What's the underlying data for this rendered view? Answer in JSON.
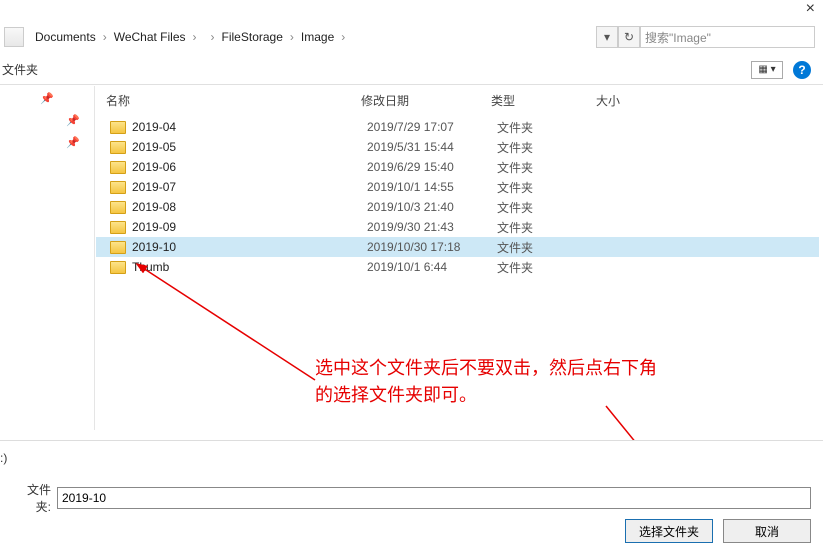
{
  "close_x": "×",
  "breadcrumb": [
    "Documents",
    "WeChat Files",
    "",
    "FileStorage",
    "Image"
  ],
  "search_placeholder": "搜索\"Image\"",
  "toolbar_left": "文件夹",
  "view_icon_text": "▦ ▾",
  "headers": {
    "name": "名称",
    "date": "修改日期",
    "type": "类型",
    "size": "大小"
  },
  "rows": [
    {
      "name": "2019-04",
      "date": "2019/7/29 17:07",
      "type": "文件夹",
      "selected": false
    },
    {
      "name": "2019-05",
      "date": "2019/5/31 15:44",
      "type": "文件夹",
      "selected": false
    },
    {
      "name": "2019-06",
      "date": "2019/6/29 15:40",
      "type": "文件夹",
      "selected": false
    },
    {
      "name": "2019-07",
      "date": "2019/10/1 14:55",
      "type": "文件夹",
      "selected": false
    },
    {
      "name": "2019-08",
      "date": "2019/10/3 21:40",
      "type": "文件夹",
      "selected": false
    },
    {
      "name": "2019-09",
      "date": "2019/9/30 21:43",
      "type": "文件夹",
      "selected": false
    },
    {
      "name": "2019-10",
      "date": "2019/10/30 17:18",
      "type": "文件夹",
      "selected": true
    },
    {
      "name": "Thumb",
      "date": "2019/10/1 6:44",
      "type": "文件夹",
      "selected": false
    }
  ],
  "annotation_l1": "选中这个文件夹后不要双击，然后点右下角",
  "annotation_l2": "的选择文件夹即可。",
  "cs_label": ":)",
  "field_label": "文件夹:",
  "field_value": "2019-10",
  "btn_select": "选择文件夹",
  "btn_cancel": "取消"
}
